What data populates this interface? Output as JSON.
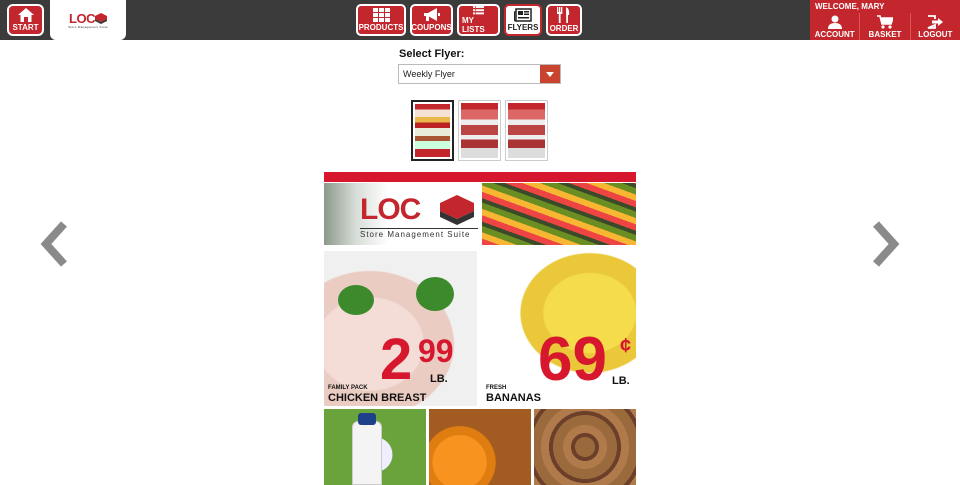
{
  "header": {
    "start_label": "START",
    "logo_text": "LOC",
    "logo_sub": "Store Management Suite",
    "nav": [
      {
        "label": "PRODUCTS",
        "icon": "grid-icon"
      },
      {
        "label": "COUPONS",
        "icon": "megaphone-icon"
      },
      {
        "label": "MY LISTS",
        "icon": "list-icon"
      },
      {
        "label": "FLYERS",
        "icon": "newspaper-icon",
        "active": true
      },
      {
        "label": "ORDER",
        "icon": "fork-knife-icon"
      }
    ],
    "welcome": "WELCOME, MARY",
    "user_buttons": [
      {
        "label": "ACCOUNT",
        "icon": "person-icon"
      },
      {
        "label": "BASKET",
        "icon": "cart-icon"
      },
      {
        "label": "LOGOUT",
        "icon": "logout-icon"
      }
    ]
  },
  "flyer_select": {
    "label": "Select Flyer:",
    "value": "Weekly Flyer"
  },
  "flyer": {
    "banner_logo": "LOC",
    "banner_sub": "Store Management Suite",
    "items": [
      {
        "prefix": "FAMILY PACK",
        "name": "CHICKEN BREAST",
        "price_main": "2",
        "price_sup": "99",
        "unit": "LB."
      },
      {
        "prefix": "FRESH",
        "name": "BANANAS",
        "price_main": "69",
        "price_sup": "¢",
        "unit": "LB."
      }
    ]
  },
  "colors": {
    "brand_red": "#c3262c",
    "dark_bar": "#3b3b3b",
    "select_arrow": "#c8442e"
  }
}
